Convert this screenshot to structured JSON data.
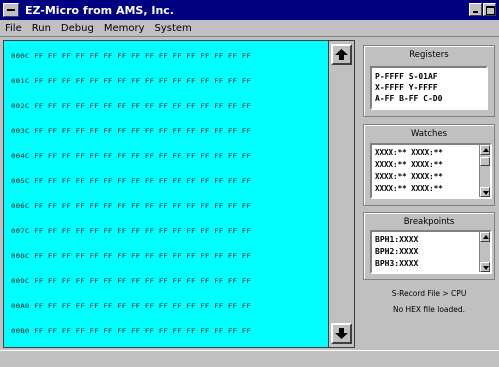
{
  "window": {
    "title": "EZ-Micro from AMS, Inc."
  },
  "menu": [
    "File",
    "Run",
    "Debug",
    "Memory",
    "System"
  ],
  "memory_rows": [
    "000C FF FF FF FF FF FF FF FF FF FF FF FF FF FF FF FF",
    "001C FF FF FF FF FF FF FF FF FF FF FF FF FF FF FF FF",
    "002C FF FF FF FF FF FF FF FF FF FF FF FF FF FF FF FF",
    "003C FF FF FF FF FF FF FF FF FF FF FF FF FF FF FF FF",
    "004C FF FF FF FF FF FF FF FF FF FF FF FF FF FF FF FF",
    "005C FF FF FF FF FF FF FF FF FF FF FF FF FF FF FF FF",
    "006C FF FF FF FF FF FF FF FF FF FF FF FF FF FF FF FF",
    "007C FF FF FF FF FF FF FF FF FF FF FF FF FF FF FF FF",
    "008C FF FF FF FF FF FF FF FF FF FF FF FF FF FF FF FF",
    "009C FF FF FF FF FF FF FF FF FF FF FF FF FF FF FF FF",
    "00A0 FF FF FF FF FF FF FF FF FF FF FF FF FF FF FF FF",
    "00B0 FF FF FF FF FF FF FF FF FF FF FF FF FF FF FF FF"
  ],
  "registers": {
    "title": "Registers",
    "lines": [
      "P-FFFF  S-01AF",
      "X-FFFF  Y-FFFF",
      "A-FF  B-FF  C-D0"
    ]
  },
  "watches": {
    "title": "Watches",
    "lines": [
      "XXXX:**   XXXX:**",
      "XXXX:**   XXXX:**",
      "XXXX:**   XXXX:**",
      "XXXX:**   XXXX:**"
    ]
  },
  "breakpoints": {
    "title": "Breakpoints",
    "lines": [
      "BPH1:XXXX",
      "BPH2:XXXX",
      "BPH3:XXXX"
    ]
  },
  "status": {
    "line1": "S-Record File > CPU",
    "line2": "No HEX file loaded."
  }
}
